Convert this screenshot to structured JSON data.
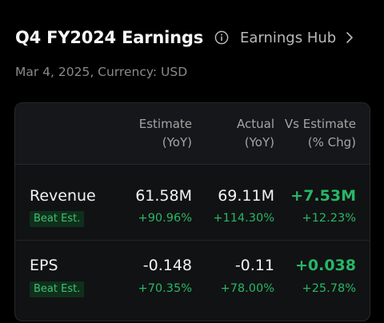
{
  "header": {
    "title": "Q4 FY2024 Earnings",
    "info_icon": "info-circle-icon",
    "hub_label": "Earnings Hub",
    "hub_icon": "chevron-right-icon"
  },
  "subtitle": "Mar 4, 2025, Currency: USD",
  "colors": {
    "positive": "#27b765",
    "badge_bg": "#0f2f1c",
    "card_bg": "#111214",
    "header_bg": "#16171a"
  },
  "table": {
    "columns": [
      {
        "label": "Estimate\n(YoY)"
      },
      {
        "label": "Actual\n(YoY)"
      },
      {
        "label": "Vs Estimate\n(% Chg)"
      }
    ],
    "rows": [
      {
        "metric": "Revenue",
        "badge": "Beat Est.",
        "estimate": "61.58M",
        "estimate_yoy": "+90.96%",
        "actual": "69.11M",
        "actual_yoy": "+114.30%",
        "vs_estimate": "+7.53M",
        "vs_estimate_pct": "+12.23%"
      },
      {
        "metric": "EPS",
        "badge": "Beat Est.",
        "estimate": "-0.148",
        "estimate_yoy": "+70.35%",
        "actual": "-0.11",
        "actual_yoy": "+78.00%",
        "vs_estimate": "+0.038",
        "vs_estimate_pct": "+25.78%"
      }
    ]
  }
}
